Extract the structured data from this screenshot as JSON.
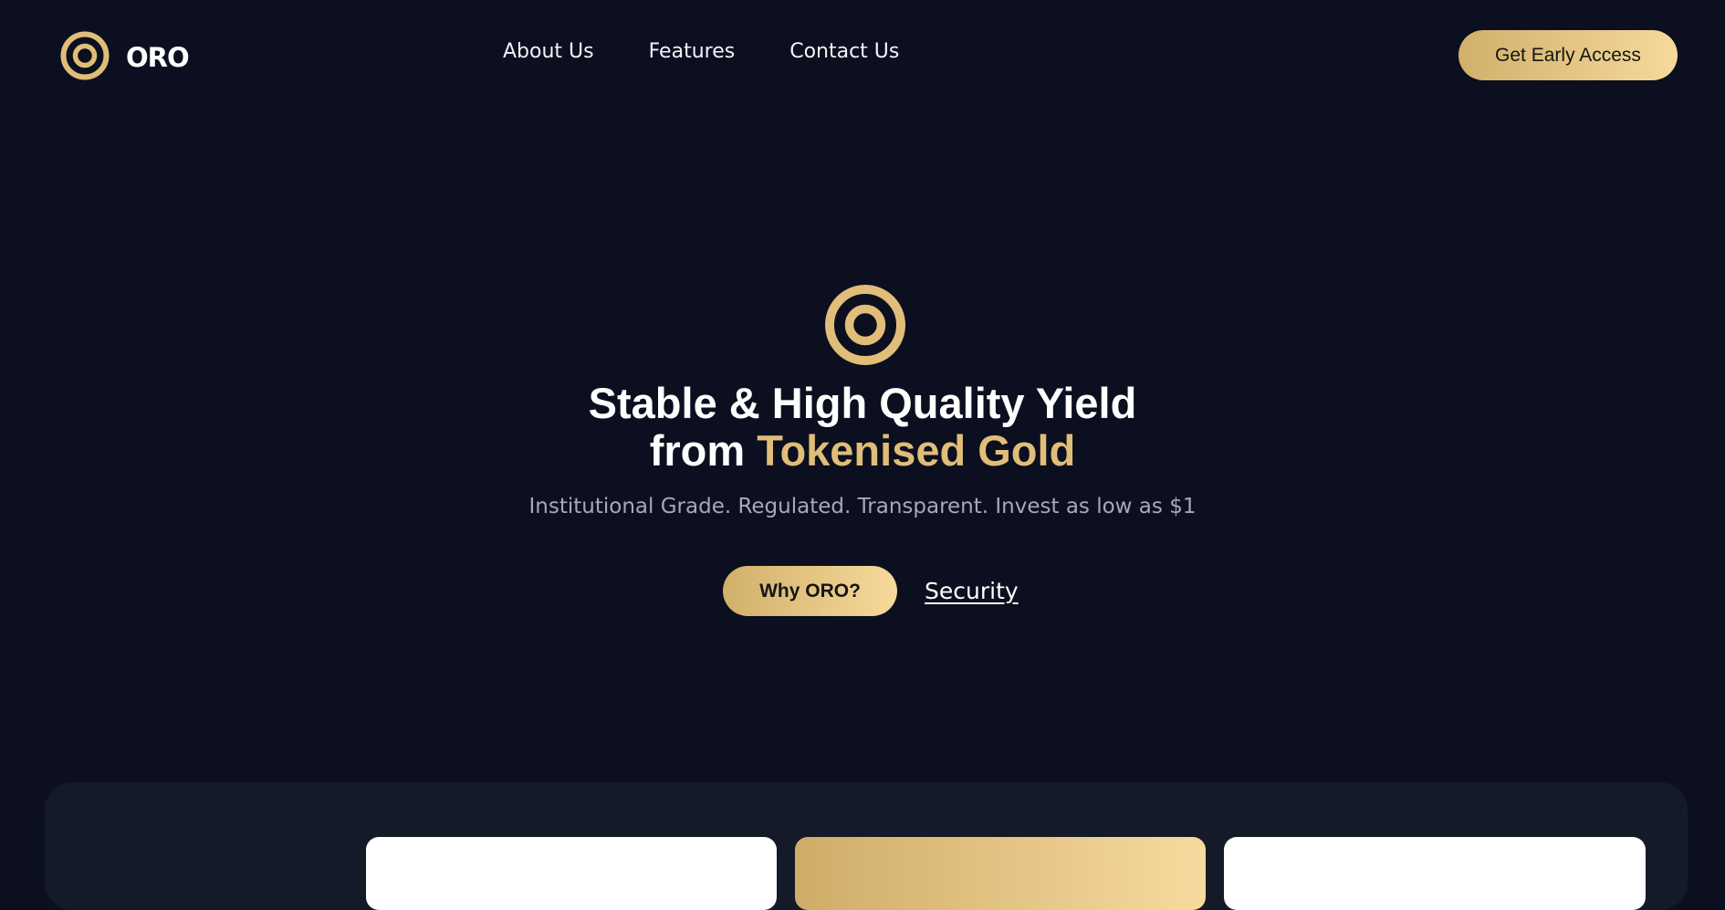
{
  "navbar": {
    "brand_name": "ORO",
    "links": [
      {
        "label": "About Us"
      },
      {
        "label": "Features"
      },
      {
        "label": "Contact Us"
      }
    ],
    "cta_label": "Get Early Access"
  },
  "hero": {
    "title_line1": "Stable & High Quality Yield",
    "title_line2_prefix": "from ",
    "title_line2_highlight": "Tokenised Gold",
    "subtitle": "Institutional Grade. Regulated. Transparent. Invest as low as $1",
    "primary_button_label": "Why ORO?",
    "secondary_link_label": "Security"
  },
  "colors": {
    "background": "#0b0f1f",
    "gold_start": "#d1b06a",
    "gold_end": "#f6d99c",
    "gold_text": "#e0bd78",
    "panel": "#151a28"
  },
  "icons": {
    "brand_logo": "oro-ring-logo-icon",
    "hero_logo": "oro-ring-logo-icon"
  }
}
